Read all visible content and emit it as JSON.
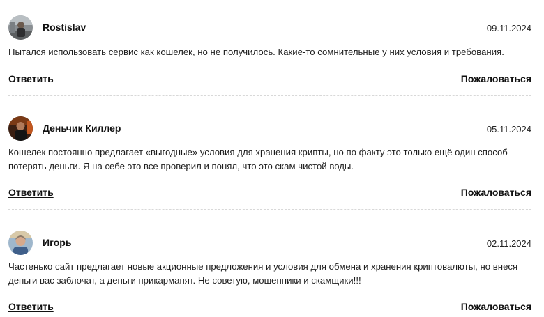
{
  "comments": [
    {
      "author": "Rostislav",
      "date": "09.11.2024",
      "text": "Пытался использовать сервис как кошелек, но не получилось. Какие-то сомнительные у них условия и требования.",
      "reply_label": "Ответить",
      "report_label": "Пожаловаться"
    },
    {
      "author": "Деньчик Киллер",
      "date": "05.11.2024",
      "text": "Кошелек постоянно предлагает «выгодные» условия для хранения крипты, но по факту это только ещё один способ потерять деньги. Я на себе это все проверил и понял, что это скам чистой воды.",
      "reply_label": "Ответить",
      "report_label": "Пожаловаться"
    },
    {
      "author": "Игорь",
      "date": "02.11.2024",
      "text": "Частенько сайт предлагает новые акционные предложения и условия для обмена и хранения криптовалюты, но внеся деньги вас заблочат, а деньги прикарманят. Не советую, мошенники и скамщики!!!",
      "reply_label": "Ответить",
      "report_label": "Пожаловаться"
    }
  ]
}
